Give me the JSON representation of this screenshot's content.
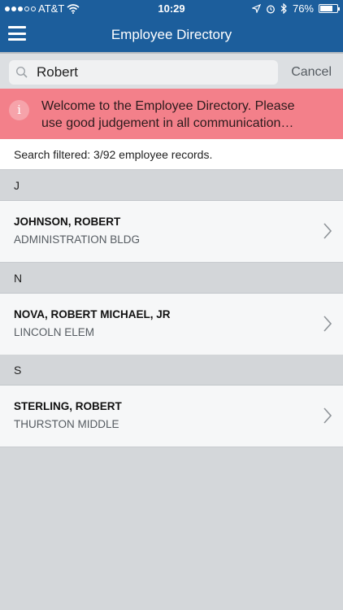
{
  "status": {
    "carrier": "AT&T",
    "time": "10:29",
    "battery": "76%",
    "battery_level": 0.76
  },
  "nav": {
    "title": "Employee Directory"
  },
  "search": {
    "value": "Robert",
    "cancel_label": "Cancel"
  },
  "banner": {
    "text": "Welcome to the Employee Directory. Please\nuse good judgement in all communication…"
  },
  "filter": {
    "text": "Search filtered: 3/92 employee records."
  },
  "sections": [
    {
      "letter": "J",
      "entries": [
        {
          "name": "JOHNSON, ROBERT",
          "location": "ADMINISTRATION BLDG"
        }
      ]
    },
    {
      "letter": "N",
      "entries": [
        {
          "name": "NOVA, ROBERT MICHAEL, JR",
          "location": "LINCOLN ELEM"
        }
      ]
    },
    {
      "letter": "S",
      "entries": [
        {
          "name": "STERLING, ROBERT",
          "location": "THURSTON MIDDLE"
        }
      ]
    }
  ],
  "colors": {
    "nav_bg": "#1c5e9c",
    "banner_bg": "#f3808a",
    "background": "#d4d7da"
  }
}
